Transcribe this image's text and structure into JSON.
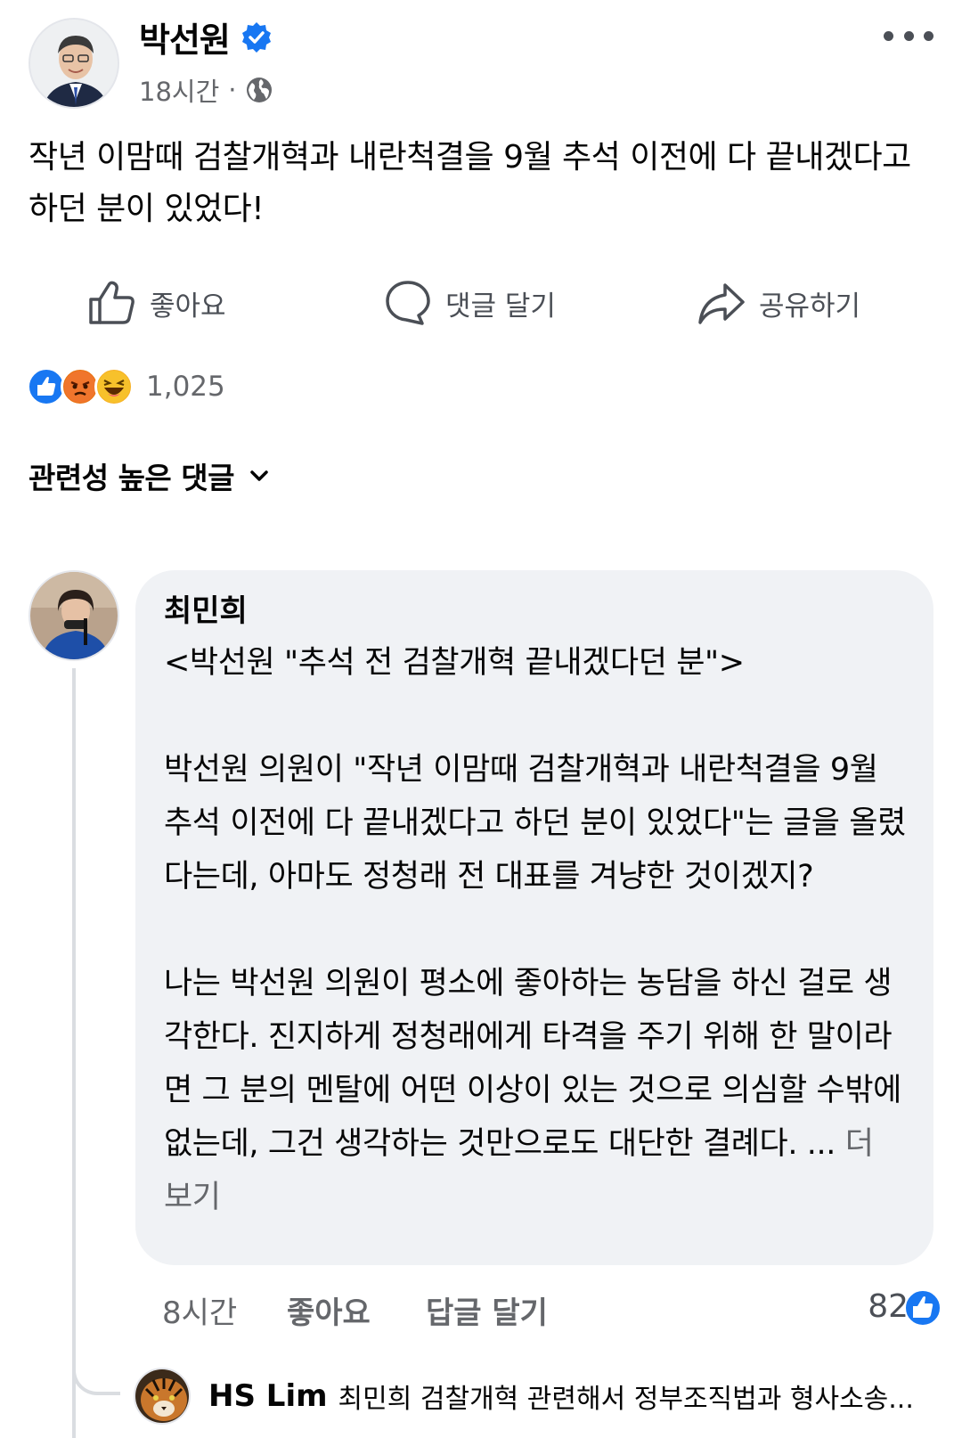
{
  "post": {
    "author": "박선원",
    "time": "18시간",
    "separator": "·",
    "text": "작년 이맘때 검찰개혁과 내란척결을 9월 추석 이전에 다 끝내겠다고 하던 분이 있었다!"
  },
  "actions": {
    "like": "좋아요",
    "comment": "댓글 달기",
    "share": "공유하기"
  },
  "reactions": {
    "icons": [
      "like-icon",
      "angry-icon",
      "haha-icon"
    ],
    "count": "1,025",
    "colors": {
      "like": "#1877f2",
      "angry": "#e9710f",
      "haha": "#f7b125"
    }
  },
  "comments_sort": {
    "label": "관련성 높은 댓글"
  },
  "comment": {
    "author": "최민희",
    "text": "<박선원 \"추석 전 검찰개혁 끝내겠다던 분\">\n\n박선원 의원이 \"작년 이맘때 검찰개혁과 내란척결을 9월 추석 이전에 다 끝내겠다고 하던 분이 있었다\"는 글을 올렸다는데, 아마도 정청래 전 대표를 겨냥한 것이겠지?\n\n나는 박선원 의원이 평소에 좋아하는 농담을 하신 걸로 생각한다. 진지하게 정청래에게 타격을 주기 위해 한 말이라면 그 분의 멘탈에 어떤 이상이 있는 것으로 의심할 수밖에 없는데, 그건 생각하는 것만으로도 대단한 결례다. ...",
    "see_more": " 더 보기",
    "time": "8시간",
    "like": "좋아요",
    "reply": "답글 달기",
    "like_count": "82"
  },
  "reply": {
    "author": "HS Lim",
    "text": "최민희 검찰개혁 관련해서 정부조직법과 형사소송..."
  }
}
